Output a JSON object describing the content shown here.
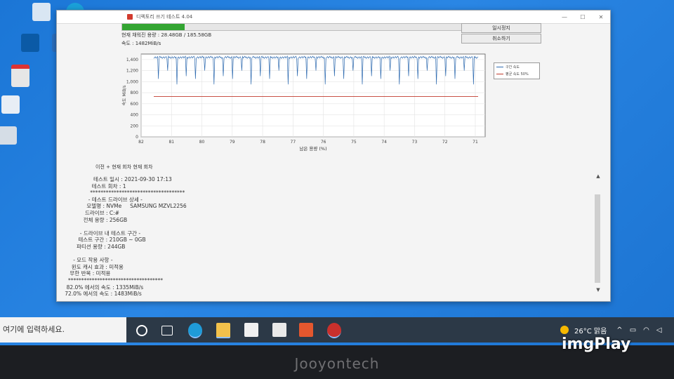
{
  "window": {
    "title": "디렉토리 쓰기 테스트 4.04",
    "capacity_label": "현재 채워진 용량 : 28.48GB / 185.58GB",
    "speed_label": "속도 : 1482MiB/s",
    "progress": 0.15,
    "buttons": {
      "pause": "일시정지",
      "cancel": "취소하기"
    },
    "tabs": "이전 + 현재 회차   현재 회차"
  },
  "chart_data": {
    "type": "line",
    "xlabel": "남은 용량 (%)",
    "ylabel": "속도 MiB/s",
    "x_ticks": [
      "82",
      "81",
      "80",
      "79",
      "78",
      "77",
      "76",
      "75",
      "74",
      "73",
      "72",
      "71"
    ],
    "y_ticks": [
      "0",
      "200",
      "400",
      "600",
      "800",
      "1,000",
      "1,200",
      "1,400"
    ],
    "ylim": [
      0,
      1500
    ],
    "series": [
      {
        "name": "구간 속도",
        "color": "#2f6bb0",
        "typical": 1440,
        "dips_to": [
          1050,
          1200,
          950,
          1100
        ]
      },
      {
        "name": "평균 속도 50%",
        "color": "#c0392b",
        "value": 730
      }
    ],
    "grid": true,
    "legend": "top-right"
  },
  "log": [
    "테스트 일시 : 2021-09-30 17:13",
    "테스트 회차 : 1",
    "************************************",
    "- 테스트 드라이브 상세 -",
    "모델명 : NVMe     SAMSUNG MZVL2256",
    "드라이브 : C:#",
    "전체 용량 : 256GB",
    "",
    "- 드라이브 내 테스트 구간 -",
    "테스트 구간 : 210GB ~ 0GB",
    "파티션 용량 : 244GB",
    "",
    "- 모드 작용 사항 -",
    "윈도 캐시 효과 : 미적용",
    "무한 반복 : 미적용",
    "************************************",
    "82.0% 에서의 속도 : 1335MiB/s",
    "72.0% 에서의 속도 : 1483MiB/s"
  ],
  "taskbar": {
    "search_placeholder": "여기에 입력하세요.",
    "weather": "26°C 맑음"
  },
  "bezel_brand": "Jooyontech",
  "watermark": "imgPlay",
  "colors": {
    "desktop": "#2a86e4",
    "progress": "#33a532",
    "series_speed": "#2f6bb0",
    "series_avg": "#c0392b"
  }
}
